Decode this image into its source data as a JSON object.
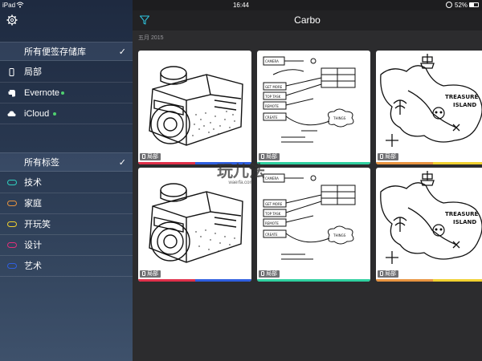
{
  "status_bar": {
    "device": "iPad",
    "time": "16:44",
    "battery_text": "52%",
    "battery_level": 0.52
  },
  "sidebar": {
    "storage_header": {
      "label": "所有便签存储库",
      "checked": true
    },
    "stores": [
      {
        "label": "局部",
        "icon": "device-icon",
        "synced": false
      },
      {
        "label": "Evernote",
        "icon": "evernote-icon",
        "synced": true,
        "sync_color": "#4fd06f"
      },
      {
        "label": "iCloud",
        "icon": "cloud-icon",
        "synced": true,
        "sync_color": "#4fd06f"
      }
    ],
    "tags_header": {
      "label": "所有标签",
      "checked": true
    },
    "tags": [
      {
        "label": "技术",
        "color": "#2fd0c0"
      },
      {
        "label": "家庭",
        "color": "#e89440"
      },
      {
        "label": "开玩笑",
        "color": "#f0d030"
      },
      {
        "label": "设计",
        "color": "#e0307a"
      },
      {
        "label": "艺术",
        "color": "#2f5fe0"
      }
    ]
  },
  "header": {
    "title": "Carbo"
  },
  "date_group": "五月 2015",
  "notes": [
    {
      "sketch": "camera",
      "location": "局部",
      "tags": [
        "#e0304a",
        "#2f5fe0"
      ]
    },
    {
      "sketch": "flow-diagram",
      "location": "局部",
      "tags": [
        "#2fd0a0",
        "#2fd0a0"
      ]
    },
    {
      "sketch": "treasure-map",
      "location": "局部",
      "tags": [
        "#e89440",
        "#f0d030"
      ]
    },
    {
      "sketch": "camera",
      "location": "局部",
      "tags": [
        "#e0304a",
        "#2f5fe0"
      ]
    },
    {
      "sketch": "flow-diagram",
      "location": "局部",
      "tags": [
        "#2fd0a0",
        "#2fd0a0"
      ]
    },
    {
      "sketch": "treasure-map",
      "location": "局部",
      "tags": [
        "#e89440",
        "#f0d030"
      ]
    }
  ],
  "watermark": {
    "text": "玩儿法",
    "sub": "waerfa.com"
  }
}
